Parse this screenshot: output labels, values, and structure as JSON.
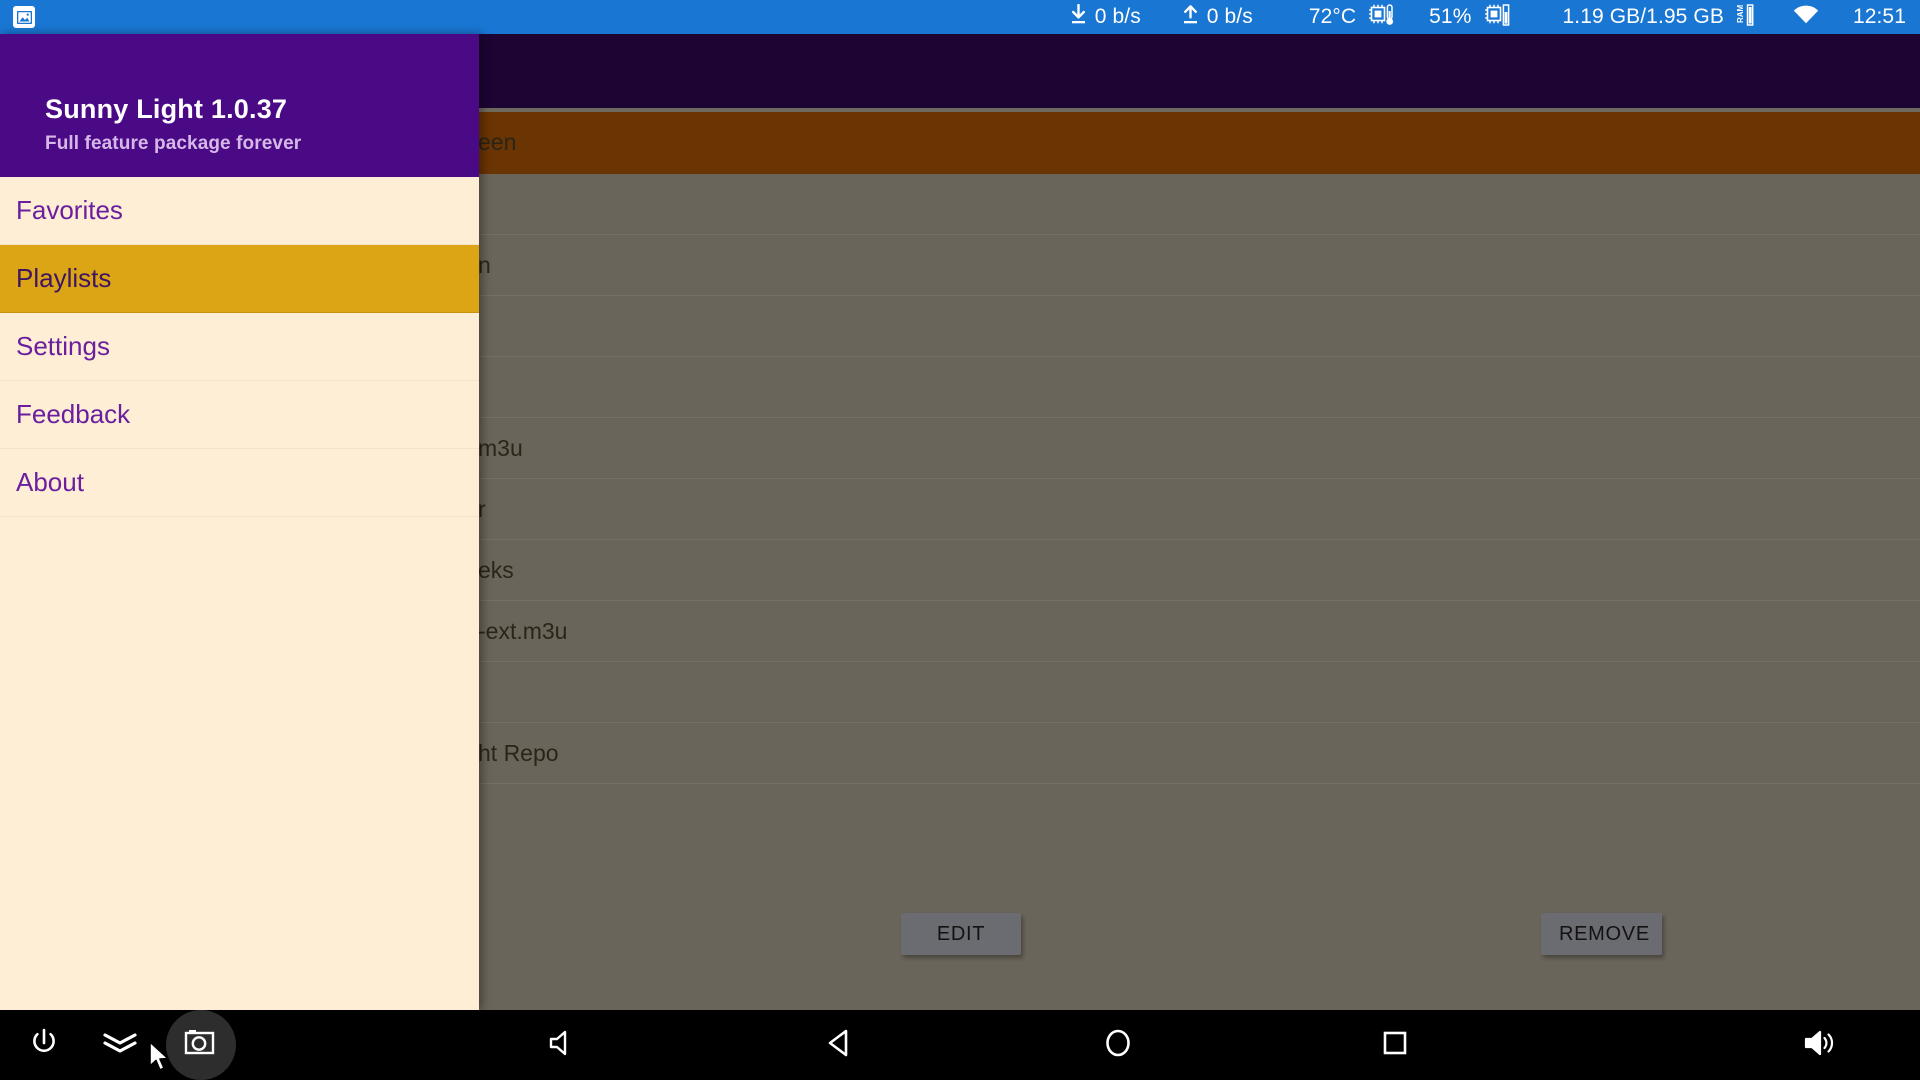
{
  "statusbar": {
    "app_icon": "image-icon",
    "download_icon": "download-arrow-icon",
    "download_speed": "0 b/s",
    "upload_icon": "upload-arrow-icon",
    "upload_speed": "0 b/s",
    "cpu_temp": "72°C",
    "cpu_temp_icon": "cpu-thermometer-icon",
    "cpu_usage": "51%",
    "cpu_usage_icon": "cpu-meter-icon",
    "ram_usage": "1.19 GB/1.95 GB",
    "ram_icon": "ram-meter-icon",
    "wifi_icon": "wifi-icon",
    "clock": "12:51",
    "background_color": "#1976d2"
  },
  "drawer": {
    "title": "Sunny Light 1.0.37",
    "subtitle": "Full feature package forever",
    "header_color": "#4b0a85",
    "background_color": "#fdeed5",
    "active_item_color": "#dca516",
    "item_text_color": "#6b1f9e",
    "items": [
      {
        "label": "Favorites",
        "active": false
      },
      {
        "label": "Playlists",
        "active": true
      },
      {
        "label": "Settings",
        "active": false
      },
      {
        "label": "Feedback",
        "active": false
      },
      {
        "label": "About",
        "active": false
      }
    ]
  },
  "background_app": {
    "scrim_color": "#6a655a",
    "appbar_color": "#1d0433",
    "selected_row_color": "#6b3403",
    "rows": [
      {
        "text": "een",
        "selected": true
      },
      {
        "text": "",
        "selected": false
      },
      {
        "text": "n",
        "selected": false
      },
      {
        "text": "",
        "selected": false
      },
      {
        "text": "",
        "selected": false
      },
      {
        "text": "m3u",
        "selected": false
      },
      {
        "text": "r",
        "selected": false
      },
      {
        "text": "eks",
        "selected": false
      },
      {
        "text": "-ext.m3u",
        "selected": false
      },
      {
        "text": "",
        "selected": false
      },
      {
        "text": "ht Repo",
        "selected": false
      }
    ],
    "buttons": {
      "edit_label": "EDIT",
      "remove_label": "REMOVE",
      "button_color": "#6b6b72"
    }
  },
  "navbar": {
    "background_color": "#000000",
    "buttons": [
      {
        "name": "power-icon",
        "label": "Power"
      },
      {
        "name": "chevron-double-down-icon",
        "label": "Expand notifications"
      },
      {
        "name": "screenshot-icon",
        "label": "Screenshot",
        "highlighted": true
      },
      {
        "name": "volume-down-icon",
        "label": "Volume down"
      },
      {
        "name": "back-triangle-icon",
        "label": "Back"
      },
      {
        "name": "home-circle-icon",
        "label": "Home"
      },
      {
        "name": "recents-square-icon",
        "label": "Recent apps"
      },
      {
        "name": "volume-up-icon",
        "label": "Volume up"
      }
    ],
    "cursor": "mouse-pointer"
  }
}
